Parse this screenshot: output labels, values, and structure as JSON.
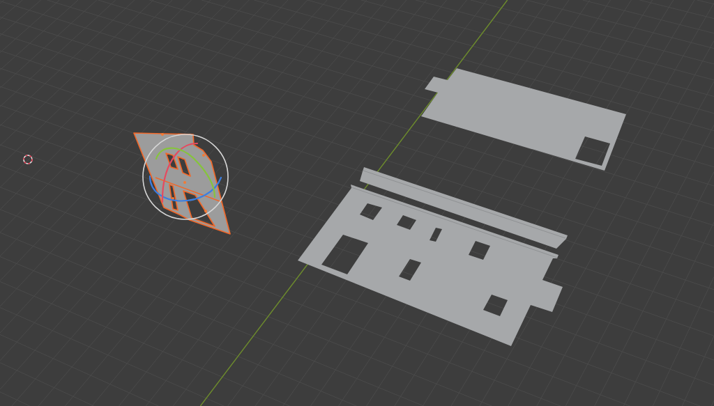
{
  "viewport": {
    "objects": [
      {
        "selected": true
      },
      {
        "selected": false
      },
      {
        "selected": false
      },
      {
        "selected": false
      }
    ]
  }
}
